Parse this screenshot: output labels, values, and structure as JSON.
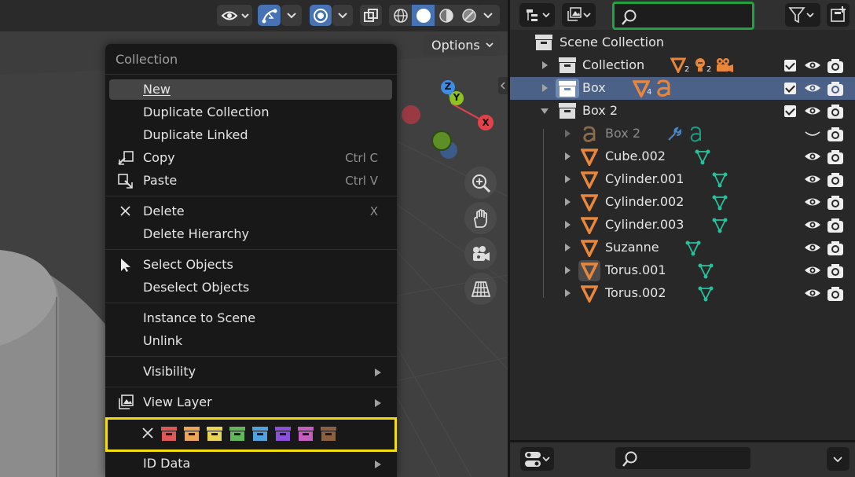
{
  "viewport": {
    "options_label": "Options",
    "gizmo": {
      "x": "X",
      "y": "Y",
      "z": "Z"
    },
    "colors": {
      "x_axis": "#e4424b",
      "y_axis": "#8dc21f",
      "z_axis": "#3d8de6",
      "highlight": "#4772b3"
    },
    "header_icons": [
      "visibility-eye-icon",
      "selectability-icon",
      "gizmo-icon",
      "overlay-icon",
      "xray-icon",
      "wireframe-shading-icon",
      "solid-shading-icon",
      "material-shading-icon",
      "rendered-shading-icon"
    ],
    "nav_icons": [
      "zoom-icon",
      "pan-hand-icon",
      "camera-view-icon",
      "ortho-grid-icon"
    ]
  },
  "menu": {
    "title": "Collection",
    "items": [
      {
        "label": "New",
        "accel": "N",
        "rest": "ew"
      },
      {
        "label": "Duplicate Collection",
        "accel": "",
        "rest": ""
      },
      {
        "label": "Duplicate Linked",
        "accel": "",
        "rest": ""
      },
      {
        "label": "Copy",
        "shortcut": "Ctrl C"
      },
      {
        "label": "Paste",
        "shortcut": "Ctrl V"
      },
      {
        "label": "Delete",
        "shortcut": "X"
      },
      {
        "label": "Delete Hierarchy"
      },
      {
        "label": "Select Objects"
      },
      {
        "label": "Deselect Objects"
      },
      {
        "label": "Instance to Scene"
      },
      {
        "label": "Unlink"
      },
      {
        "label": "Visibility"
      },
      {
        "label": "View Layer"
      },
      {
        "label": "ID Data"
      }
    ],
    "color_tags": [
      "#e05757",
      "#efa556",
      "#e9d454",
      "#63b75b",
      "#4fa3de",
      "#8a52d8",
      "#c45fc0",
      "#8a6040"
    ]
  },
  "outliner": {
    "rows": [
      {
        "label": "Scene Collection"
      },
      {
        "label": "Collection",
        "badges": [
          "2",
          "2"
        ]
      },
      {
        "label": "Box",
        "badges": [
          "4"
        ]
      },
      {
        "label": "Box 2"
      },
      {
        "label": "Box 2"
      },
      {
        "label": "Cube.002"
      },
      {
        "label": "Cylinder.001"
      },
      {
        "label": "Cylinder.002"
      },
      {
        "label": "Cylinder.003"
      },
      {
        "label": "Suzanne"
      },
      {
        "label": "Torus.001"
      },
      {
        "label": "Torus.002"
      }
    ],
    "colors": {
      "object_orange": "#e8863b",
      "mesh_green": "#23c29c",
      "selected_row": "#4c6187",
      "search_outline": "#21a242"
    },
    "row_icons": [
      "collection-icon",
      "object-triangle-icon",
      "mesh-data-icon",
      "eye-icon",
      "camera-icon",
      "checkbox-icon"
    ]
  }
}
